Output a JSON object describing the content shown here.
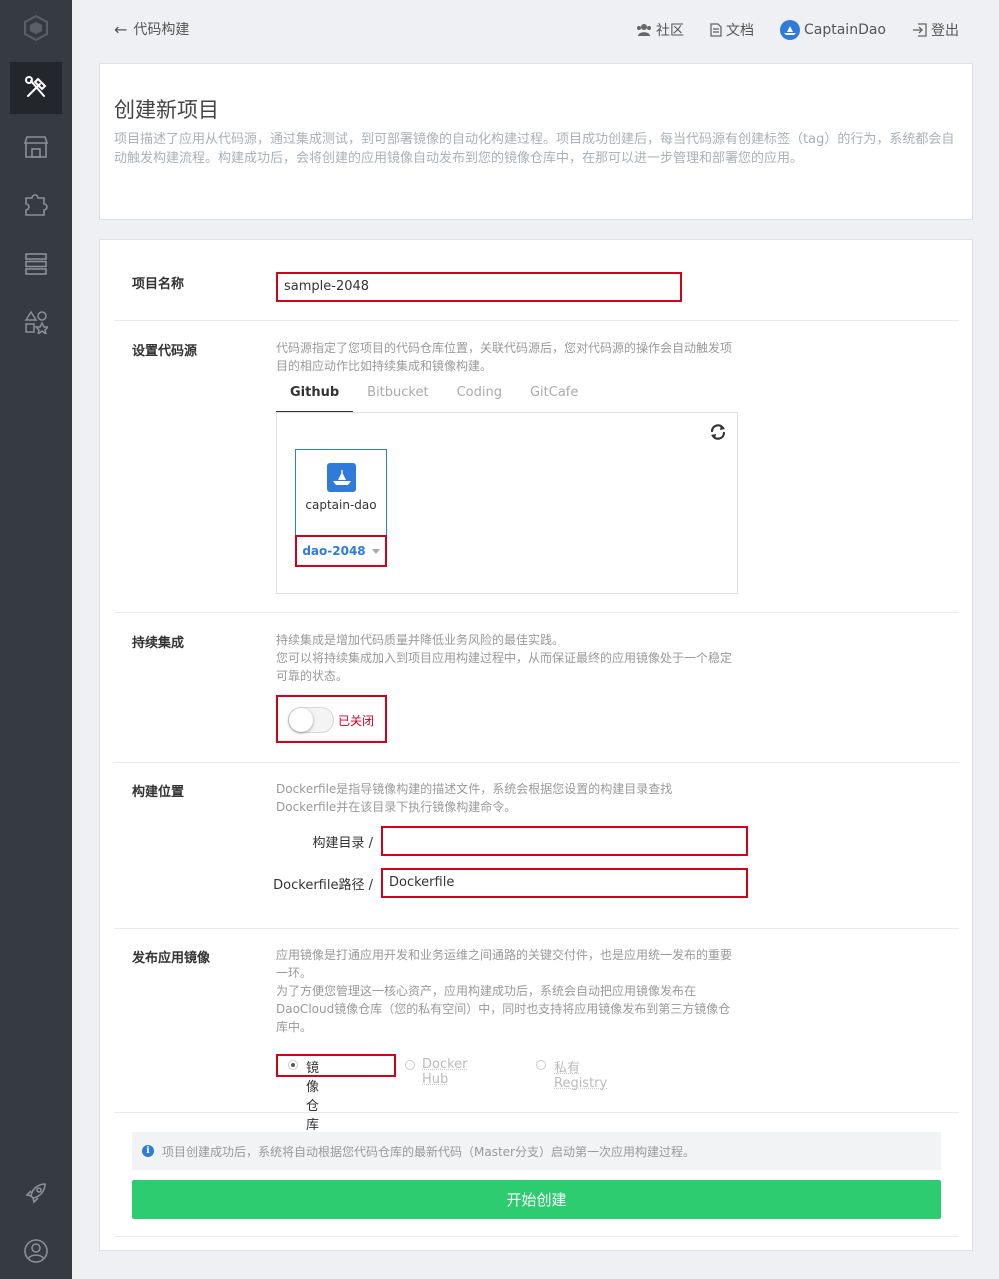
{
  "header": {
    "back_label": "代码构建",
    "nav": [
      {
        "icon": "users-icon",
        "label": "社区"
      },
      {
        "icon": "document-icon",
        "label": "文档"
      },
      {
        "icon": "avatar",
        "label": "CaptainDao"
      },
      {
        "icon": "logout-icon",
        "label": "登出"
      }
    ]
  },
  "sidebar": {
    "items": [
      "logo-icon",
      "build-tools-icon",
      "store-icon",
      "puzzle-icon",
      "server-icon",
      "shapes-icon",
      "rocket-icon",
      "user-icon"
    ],
    "active": "build-tools-icon"
  },
  "intro": {
    "title": "创建新项目",
    "description": "项目描述了应用从代码源，通过集成测试，到可部署镜像的自动化构建过程。项目成功创建后，每当代码源有创建标签（tag）的行为，系统都会自动触发构建流程。构建成功后，会将创建的应用镜像自动发布到您的镜像仓库中，在那可以进一步管理和部署您的应用。"
  },
  "form": {
    "project_name": {
      "label": "项目名称",
      "value": "sample-2048"
    },
    "source": {
      "label": "设置代码源",
      "help": "代码源指定了您项目的代码仓库位置，关联代码源后，您对代码源的操作会自动触发项目的相应动作比如持续集成和镜像构建。",
      "tabs": [
        "Github",
        "Bitbucket",
        "Coding",
        "GitCafe"
      ],
      "active_tab": "Github",
      "org_name": "captain-dao",
      "repo": "dao-2048"
    },
    "ci": {
      "label": "持续集成",
      "help1": "持续集成是增加代码质量并降低业务风险的最佳实践。",
      "help2": "您可以将持续集成加入到项目应用构建过程中，从而保证最终的应用镜像处于一个稳定可靠的状态。",
      "toggle_state": "已关闭",
      "enabled": false
    },
    "build_location": {
      "label": "构建位置",
      "help": "Dockerfile是指导镜像构建的描述文件，系统会根据您设置的构建目录查找Dockerfile并在该目录下执行镜像构建命令。",
      "dir_label": "构建目录 /",
      "dir_value": "",
      "dockerfile_label": "Dockerfile路径 /",
      "dockerfile_value": "Dockerfile"
    },
    "publish": {
      "label": "发布应用镜像",
      "help1": "应用镜像是打通应用开发和业务运维之间通路的关键交付件，也是应用统一发布的重要一环。",
      "help2": "为了方便您管理这一核心资产，应用构建成功后，系统会自动把应用镜像发布在DaoCloud镜像仓库（您的私有空间）中，同时也支持将应用镜像发布到第三方镜像仓库中。",
      "options": [
        "镜像仓库",
        "Docker Hub",
        "私有Registry"
      ],
      "selected": "镜像仓库"
    },
    "notice": "项目创建成功后，系统将自动根据您代码仓库的最新代码（Master分支）启动第一次应用构建过程。",
    "submit_label": "开始创建"
  },
  "colors": {
    "sidebar_bg": "#363b42",
    "accent_blue": "#2f7bd9",
    "highlight_red": "#d0021b",
    "submit_green": "#2ecc71"
  }
}
